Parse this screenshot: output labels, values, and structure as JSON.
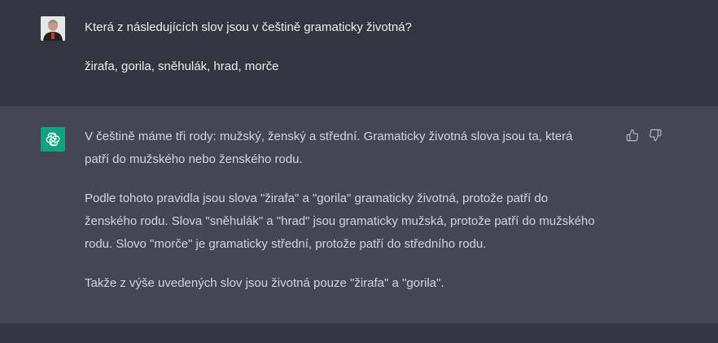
{
  "user_message": {
    "avatar_icon": "user-avatar-photo",
    "paragraphs": [
      "Která z následujících slov jsou v češtině gramaticky životná?",
      "žirafa, gorila, sněhulák, hrad, morče"
    ]
  },
  "assistant_message": {
    "avatar_icon": "openai-logo-icon",
    "avatar_color": "#10a37f",
    "paragraphs": [
      "V češtině máme tři rody: mužský, ženský a střední. Gramaticky životná slova jsou ta, která patří do mužského nebo ženského rodu.",
      "Podle tohoto pravidla jsou slova \"žirafa\" a \"gorila\" gramaticky životná, protože patří do ženského rodu. Slova \"sněhulák\" a \"hrad\" jsou gramaticky mužská, protože patří do mužského rodu. Slovo \"morče\" je gramaticky střední, protože patří do středního rodu.",
      "Takže z výše uvedených slov jsou životná pouze \"žirafa\" a \"gorila\"."
    ],
    "feedback": {
      "thumbs_up_icon": "thumbs-up-icon",
      "thumbs_down_icon": "thumbs-down-icon"
    }
  },
  "colors": {
    "user_bg": "#343541",
    "assistant_bg": "#444654",
    "text": "#ececf1"
  }
}
